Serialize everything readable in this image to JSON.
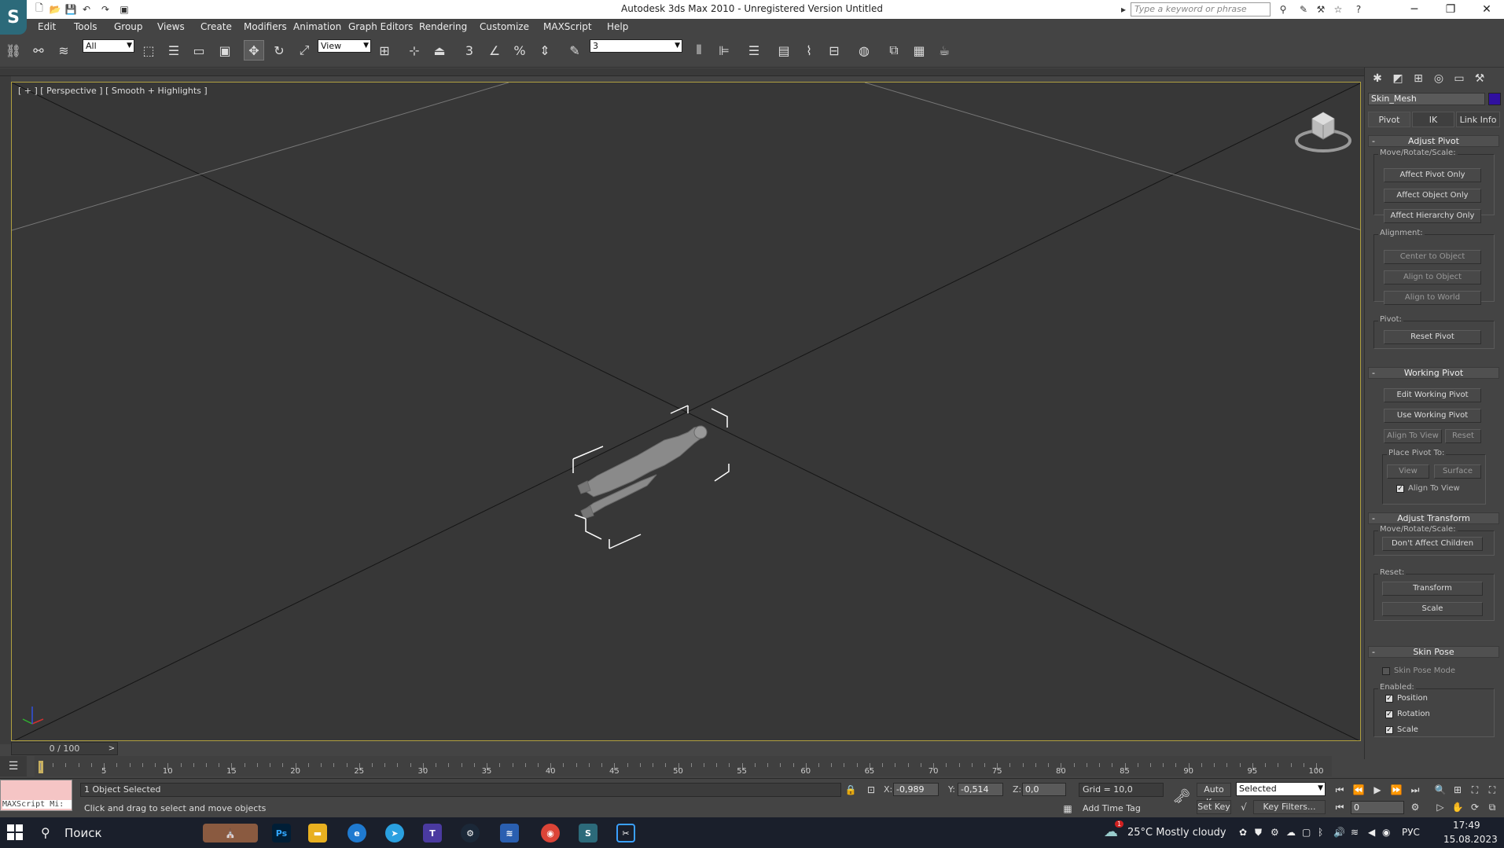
{
  "window": {
    "title": "Autodesk 3ds Max  2010  - Unregistered Version      Untitled",
    "search_placeholder": "Type a keyword or phrase",
    "minimize": "─",
    "restore": "❐",
    "close": "✕"
  },
  "menu": [
    "Edit",
    "Tools",
    "Group",
    "Views",
    "Create",
    "Modifiers",
    "Animation",
    "Graph Editors",
    "Rendering",
    "Customize",
    "MAXScript",
    "Help"
  ],
  "toolbar": {
    "selection_filter": "All",
    "ref_coord": "View",
    "named_selection": "3"
  },
  "viewport": {
    "label": "[ + ] [ Perspective ] [ Smooth + Highlights ]"
  },
  "command_panel": {
    "object_name": "Skin_Mesh",
    "object_color": "#3010a0",
    "subtabs": [
      "Pivot",
      "IK",
      "Link Info"
    ],
    "adjust_pivot": {
      "title": "Adjust Pivot",
      "move_label": "Move/Rotate/Scale:",
      "affect_pivot": "Affect Pivot Only",
      "affect_object": "Affect Object Only",
      "affect_hierarchy": "Affect Hierarchy Only",
      "alignment_label": "Alignment:",
      "center_to_object": "Center to Object",
      "align_to_object": "Align to Object",
      "align_to_world": "Align to World",
      "pivot_label": "Pivot:",
      "reset_pivot": "Reset Pivot"
    },
    "working_pivot": {
      "title": "Working Pivot",
      "edit": "Edit Working Pivot",
      "use": "Use Working Pivot",
      "align_to_view": "Align To View",
      "reset": "Reset",
      "place_label": "Place Pivot To:",
      "view": "View",
      "surface": "Surface",
      "align_check": "Align To View"
    },
    "adjust_transform": {
      "title": "Adjust Transform",
      "move_label": "Move/Rotate/Scale:",
      "dont_affect": "Don't Affect Children",
      "reset_label": "Reset:",
      "transform": "Transform",
      "scale": "Scale"
    },
    "skin_pose": {
      "title": "Skin Pose",
      "mode": "Skin Pose Mode",
      "enabled_label": "Enabled:",
      "position": "Position",
      "rotation": "Rotation",
      "scale": "Scale"
    }
  },
  "timeline": {
    "slider": "0 / 100",
    "next": ">",
    "ticks": [
      "5",
      "10",
      "15",
      "20",
      "25",
      "30",
      "35",
      "40",
      "45",
      "50",
      "55",
      "60",
      "65",
      "70",
      "75",
      "80",
      "85",
      "90",
      "95",
      "100"
    ]
  },
  "status": {
    "maxscript": "MAXScript Mi:",
    "selected": "1 Object Selected",
    "prompt": "Click and drag to select and move objects",
    "x_label": "X:",
    "x": "-0,989",
    "y_label": "Y:",
    "y": "-0,514",
    "z_label": "Z:",
    "z": "0,0",
    "grid": "Grid = 10,0",
    "add_time_tag": "Add Time Tag",
    "auto_key": "Auto Key",
    "set_key": "Set Key",
    "key_mode": "Selected",
    "key_filters": "Key Filters...",
    "frame": "0"
  },
  "taskbar": {
    "search": "Поиск",
    "weather": "25°C  Mostly cloudy",
    "lang": "РУС",
    "time": "17:49",
    "date": "15.08.2023",
    "notif": "1"
  }
}
